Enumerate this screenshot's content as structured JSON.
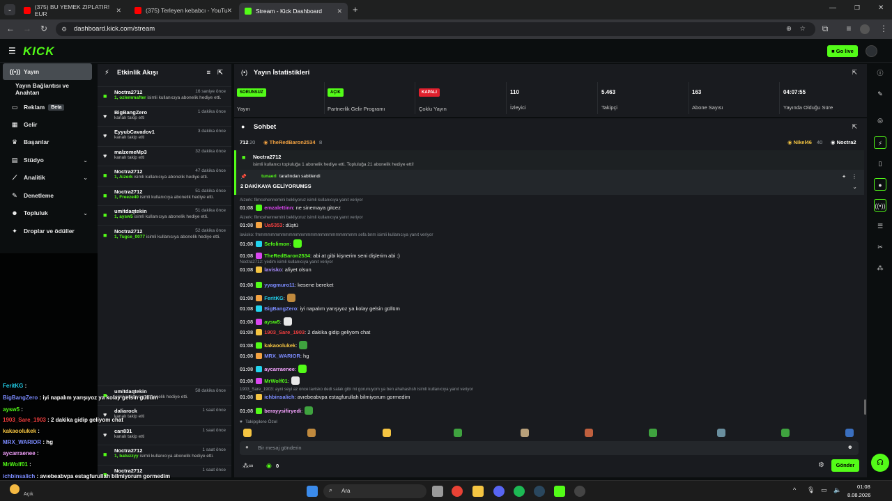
{
  "browser": {
    "tabs": [
      {
        "title": "(375) BU YEMEK ZIPLATIR! EUR",
        "icon": "youtube-icon"
      },
      {
        "title": "(375) Terleyen kebabcı - YouTu",
        "icon": "youtube-icon"
      },
      {
        "title": "Stream - Kick Dashboard",
        "icon": "kick-icon"
      }
    ],
    "url": "dashboard.kick.com/stream"
  },
  "topbar": {
    "logo": "KICK",
    "go_live": "Go live"
  },
  "nav": [
    {
      "label": "Yayın",
      "icon": "broadcast-icon"
    },
    {
      "label": "Yayın Bağlantısı ve Anahtarı",
      "icon": ""
    },
    {
      "label": "Reklam",
      "icon": "ad-icon",
      "badge": "Beta"
    },
    {
      "label": "Gelir",
      "icon": "money-icon"
    },
    {
      "label": "Başarılar",
      "icon": "trophy-icon"
    },
    {
      "label": "Stüdyo",
      "icon": "studio-icon"
    },
    {
      "label": "Analitik",
      "icon": "analytics-icon"
    },
    {
      "label": "Denetleme",
      "icon": "moderation-icon"
    },
    {
      "label": "Topluluk",
      "icon": "community-icon"
    },
    {
      "label": "Droplar ve ödüller",
      "icon": "drops-icon"
    }
  ],
  "events": {
    "title": "Etkinlik Akışı",
    "items": [
      {
        "user": "Noctra2712",
        "time": "16 saniye önce",
        "type": "gift",
        "line1": "1, ozlemmafter",
        "line2": " isimli kullanıcıya abonelik hediye etti."
      },
      {
        "user": "BigBangZero",
        "time": "1 dakika önce",
        "type": "follow",
        "line1": "",
        "line2": "kanalı takip etti"
      },
      {
        "user": "EyyubCavadov1",
        "time": "3 dakika önce",
        "type": "follow",
        "line1": "",
        "line2": "kanalı takip etti"
      },
      {
        "user": "malzemeMp3",
        "time": "32 dakika önce",
        "type": "follow",
        "line1": "",
        "line2": "kanalı takip etti"
      },
      {
        "user": "Noctra2712",
        "time": "47 dakika önce",
        "type": "gift",
        "line1": "1, Aizerk",
        "line2": " isimli kullanıcıya abonelik hediye etti."
      },
      {
        "user": "Noctra2712",
        "time": "51 dakika önce",
        "type": "gift",
        "line1": "1, Freeze40",
        "line2": " isimli kullanıcıya abonelik hediye etti."
      },
      {
        "user": "umitdaqtekin",
        "time": "51 dakika önce",
        "type": "gift",
        "line1": "1, aysw5",
        "line2": " isimli kullanıcıya abonelik hediye etti."
      },
      {
        "user": "Noctra2712",
        "time": "52 dakika önce",
        "type": "gift",
        "line1": "1, Tugce_0077",
        "line2": " isimli kullanıcıya abonelik hediye etti."
      }
    ],
    "lower": [
      {
        "user": "umitdaqtekin",
        "time": "58 dakika önce",
        "type": "gift",
        "line1": "",
        "line2": "isimli kullanıcıya abonelik hediye etti."
      },
      {
        "user": "daliarock",
        "time": "1 saat önce",
        "type": "follow",
        "line1": "",
        "line2": "kanalı takip etti"
      },
      {
        "user": "can831",
        "time": "1 saat önce",
        "type": "follow",
        "line1": "",
        "line2": "kanalı takip etti"
      },
      {
        "user": "Noctra2712",
        "time": "1 saat önce",
        "type": "gift",
        "line1": "1, batuzzyy",
        "line2": " isimli kullanıcıya abonelik hediye etti."
      },
      {
        "user": "Noctra2712",
        "time": "1 saat önce",
        "type": "gift",
        "line1": "",
        "line2": ""
      }
    ]
  },
  "stats": {
    "title": "Yayın İstatistikleri",
    "items": [
      {
        "badge": "SORUNSUZ",
        "badge_color": "#53fc18",
        "label": "Yayın"
      },
      {
        "badge": "AÇIK",
        "badge_color": "#53fc18",
        "label": "Partnerlik Gelir Programı"
      },
      {
        "badge": "KAPALI",
        "badge_color": "#e0202d",
        "label": "Çoklu Yayın"
      },
      {
        "value": "110",
        "label": "İzleyici"
      },
      {
        "value": "5.463",
        "label": "Takipçi"
      },
      {
        "value": "163",
        "label": "Abone Sayısı"
      },
      {
        "value": "04:07:55",
        "label": "Yayında Olduğu Süre"
      }
    ]
  },
  "chat": {
    "title": "Sohbet",
    "leaderboard": {
      "count1": "712",
      "count2": "20",
      "user1": "TheRedBaron2534",
      "n1": "8",
      "user2": "Nikel46",
      "n2": "40",
      "user3": "Noctra2"
    },
    "gift_banner": {
      "user": "Noctra2712",
      "text": "isimli kullanıcı topluluğa 1 abonelik hediye etti. Topluluğa 21 abonelik hediye etti!"
    },
    "pinned": {
      "by": "tunaerl",
      "by_text": "tarafından sabitlendi",
      "text": "2 DAKİKAYA GELİYORUMSS"
    },
    "messages": [
      {
        "reply": "Aizerk: filmcehennemini bekliyoruz isimli kullanıcıya yanıt veriyor",
        "time": "01:08",
        "user": "emzalettinn",
        "color": "#d946ef",
        "text": ": ne sinemaya gitcez"
      },
      {
        "reply": "Aizerk: filmcehennemini bekliyoruz isimli kullanıcıya yanıt veriyor",
        "time": "01:08",
        "user": "Ua5353",
        "color": "#f43f3f",
        "text": ": düştü"
      },
      {
        "reply": "lavisko: fmmmmmmmmmmmmmmmmmmmmmmmmmmmm sefa bnm isimli kullanıcıya yanıt veriyor",
        "time": "01:08",
        "user": "Sefolimon",
        "color": "#53fc18",
        "text": ":"
      },
      {
        "reply": "",
        "time": "01:08",
        "user": "TheRedBaron2534",
        "color": "#53fc18",
        "text": ": abi at gibi kişnerim seni dişlerim abi :)"
      },
      {
        "reply": "Noctra2712: yedim isimli kullanıcıya yanıt veriyor",
        "time": "01:08",
        "user": "lavisko",
        "color": "#a78bfa",
        "text": ": afiyet olsun"
      },
      {
        "reply": "",
        "time": "01:08",
        "user": "yyagmuro11",
        "color": "#7c8cff",
        "text": ": kesene bereket"
      },
      {
        "reply": "",
        "time": "01:08",
        "user": "FeritKG",
        "color": "#22d3ee",
        "text": ":"
      },
      {
        "reply": "",
        "time": "01:08",
        "user": "BigBangZero",
        "color": "#7c8cff",
        "text": ": iyi napalım yarışıyoz ya kolay gelsin güllüm"
      },
      {
        "reply": "",
        "time": "01:08",
        "user": "aysw5",
        "color": "#53fc18",
        "text": ":"
      },
      {
        "reply": "",
        "time": "01:08",
        "user": "1903_Sare_1903",
        "color": "#f43f3f",
        "text": ": 2 dakika gidip geliyom chat"
      },
      {
        "reply": "",
        "time": "01:08",
        "user": "kakaoolukek",
        "color": "#f5c542",
        "text": ":"
      },
      {
        "reply": "",
        "time": "01:08",
        "user": "MRX_WARIOR",
        "color": "#7c8cff",
        "text": ": hg"
      },
      {
        "reply": "",
        "time": "01:08",
        "user": "aycarraenee",
        "color": "#f5a3ff",
        "text": ":"
      },
      {
        "reply": "",
        "time": "01:08",
        "user": "MrWolf01",
        "color": "#53fc18",
        "text": ":"
      },
      {
        "reply": "1903_Sare_1903: ayni seyi az once lavisko dedi salak gibi mi gorunuyom ya ben ahahashsh isimli kullanıcıya yanıt veriyor",
        "time": "01:08",
        "user": "ichbinsalich",
        "color": "#7c8cff",
        "text": ": avıebeabvpa estagfurullah bilmiyorum gormedim"
      },
      {
        "reply": "",
        "time": "01:08",
        "user": "berayysifiryedi",
        "color": "#f5a3ff",
        "text": ":"
      }
    ],
    "emote_bar_label": "Takipçilere Özel",
    "input_placeholder": "Bir mesaj gönderin",
    "points": "0",
    "send": "Gönder"
  },
  "overlay_chat": [
    {
      "user": "FeritKG",
      "color": "#22d3ee",
      "text": " :"
    },
    {
      "user": "BigBangZero",
      "color": "#7c8cff",
      "text": " : iyi napalım yarışıyoz ya kolay gelsin güllüm"
    },
    {
      "user": "aysw5",
      "color": "#53fc18",
      "text": " :"
    },
    {
      "user": "1903_Sare_1903",
      "color": "#f43f3f",
      "text": " : 2 dakika gidip geliyom chat"
    },
    {
      "user": "kakaoolukek",
      "color": "#f5c542",
      "text": " :"
    },
    {
      "user": "MRX_WARIOR",
      "color": "#7c8cff",
      "text": " : hg"
    },
    {
      "user": "aycarraenee",
      "color": "#f5a3ff",
      "text": " :"
    },
    {
      "user": "MrWolf01",
      "color": "#53fc18",
      "text": " :"
    },
    {
      "user": "ichbinsalich",
      "color": "#7c8cff",
      "text": " : avıebeabvpa estagfurullah bilmiyorum gormedim"
    },
    {
      "user": "berayysifiryedi",
      "color": "#f5a3ff",
      "text": " :"
    }
  ],
  "taskbar": {
    "search": "Ara",
    "time": "01:08",
    "date": "8.08.2026",
    "weather_label": "Açık"
  },
  "colors": {
    "accent": "#53fc18",
    "bg": "#0b0e0f",
    "panel": "#191b1f"
  }
}
